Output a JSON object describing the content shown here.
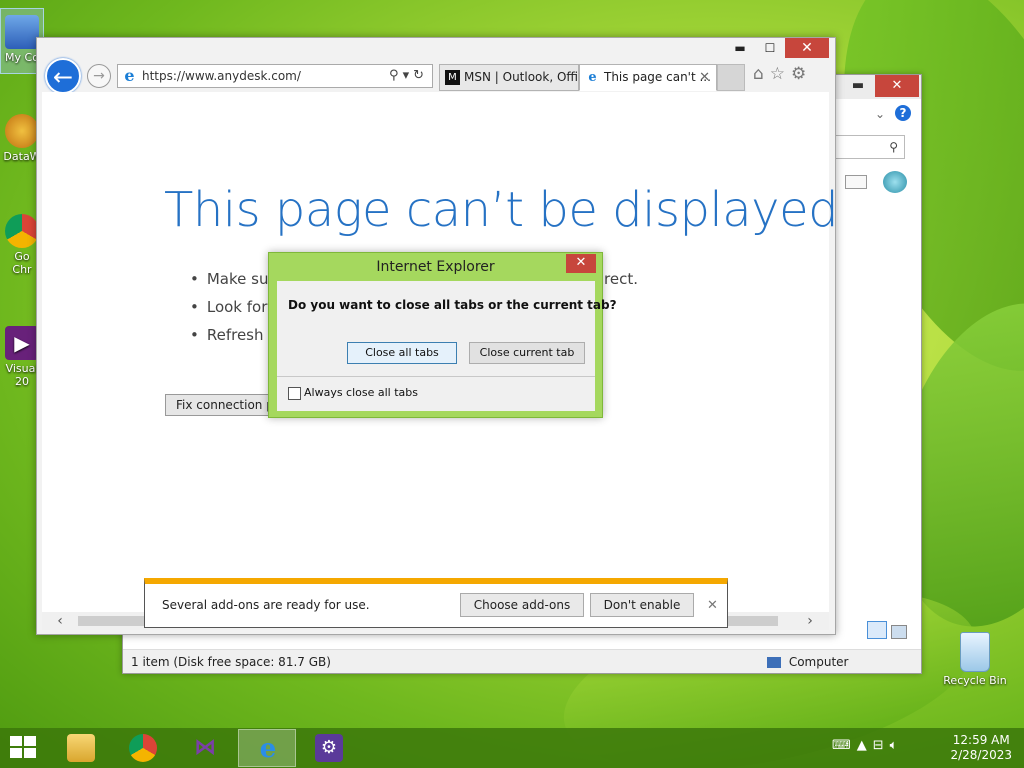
{
  "desktop": {
    "icons": [
      {
        "label": "My Co",
        "icon": "computer-icon"
      },
      {
        "label": "DataW",
        "icon": "datawave-icon"
      },
      {
        "label": "Go\nChr",
        "icon": "chrome-icon"
      },
      {
        "label": "Visual\n20",
        "icon": "visual-studio-icon"
      },
      {
        "label": "Recycle Bin",
        "icon": "recycle-bin-icon"
      }
    ]
  },
  "explorer": {
    "status_items": "1 item (Disk free space: 81.7 GB)",
    "status_location": "Computer"
  },
  "ie": {
    "address_url": "https://www.anydesk.com/",
    "tabs": [
      {
        "label": "MSN | Outlook, Offi...",
        "icon": "msn-icon"
      },
      {
        "label": "This page can't ...",
        "icon": "ie-icon",
        "active": true
      }
    ],
    "page": {
      "title": "This page can’t be displayed",
      "bullets": [
        "Make sure",
        "Look for t",
        "Refresh th"
      ],
      "bullet_tail": "rect.",
      "fix_button": "Fix connection pro"
    },
    "notification": {
      "message": "Several add-ons are ready for use.",
      "choose_label": "Choose add-ons",
      "dont_label": "Don't enable"
    }
  },
  "dialog": {
    "title": "Internet Explorer",
    "question": "Do you want to close all tabs or the current tab?",
    "close_all_label": "Close all tabs",
    "close_current_label": "Close current tab",
    "always_label": "Always close all tabs",
    "always_checked": false
  },
  "taskbar": {
    "apps": [
      {
        "name": "file-explorer",
        "active": false
      },
      {
        "name": "chrome",
        "active": false
      },
      {
        "name": "visual-studio",
        "active": false
      },
      {
        "name": "internet-explorer",
        "active": true
      },
      {
        "name": "settings",
        "active": false
      }
    ],
    "time": "12:59 AM",
    "date": "2/28/2023"
  },
  "colors": {
    "accent_blue": "#2672c4",
    "close_red": "#c7463c",
    "notify_orange": "#f5a800",
    "dialog_green": "#a5d85e"
  }
}
